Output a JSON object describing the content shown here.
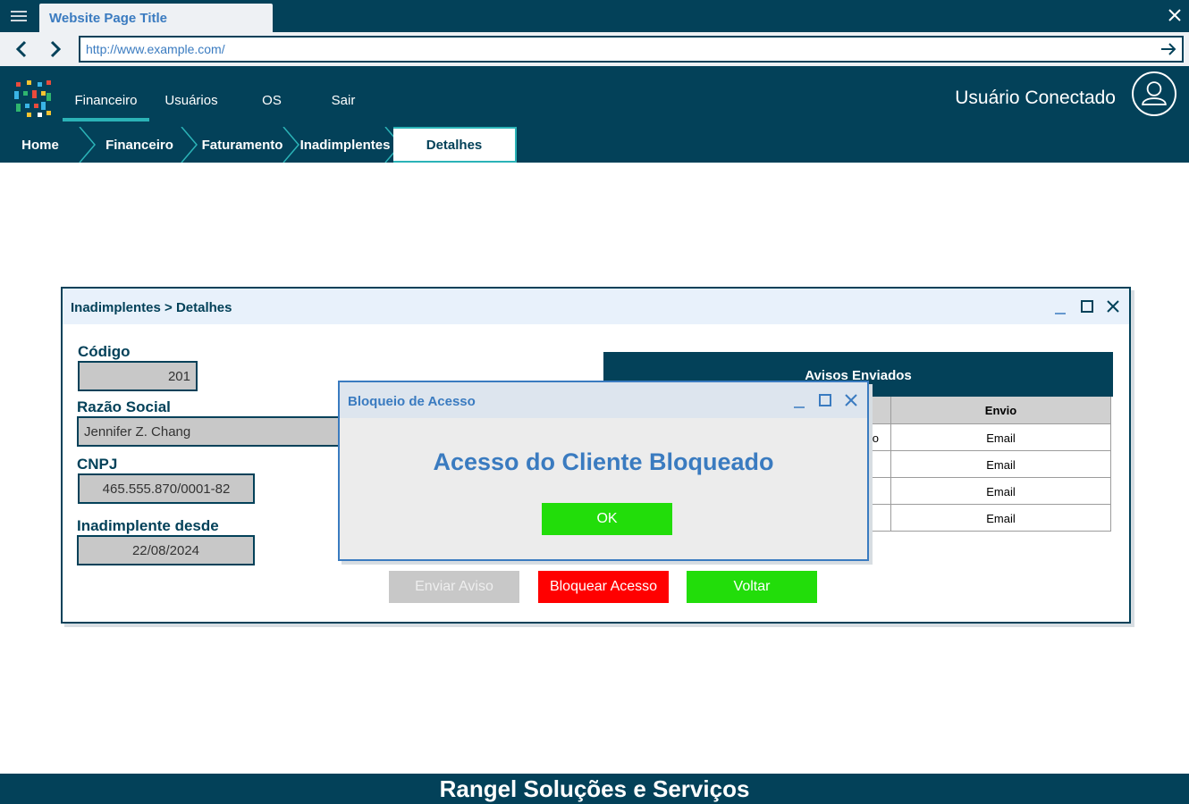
{
  "browser": {
    "tab_title": "Website Page Title",
    "url": "http://www.example.com/"
  },
  "header": {
    "nav": [
      {
        "label": "Financeiro",
        "active": true
      },
      {
        "label": "Usuários",
        "active": false
      },
      {
        "label": "OS",
        "active": false
      },
      {
        "label": "Sair",
        "active": false
      }
    ],
    "user_label": "Usuário Conectado",
    "logo_colors": [
      "#e94b3c",
      "#f5c431",
      "#3ab5e6",
      "#2fb56e"
    ]
  },
  "breadcrumb": [
    "Home",
    "Financeiro",
    "Faturamento",
    "Inadimplentes",
    "Detalhes"
  ],
  "window": {
    "title": "Inadimplentes > Detalhes",
    "fields": {
      "codigo": {
        "label": "Código",
        "value": "201"
      },
      "razao_social": {
        "label": "Razão Social",
        "value": "Jennifer Z. Chang"
      },
      "cnpj": {
        "label": "CNPJ",
        "value": "465.555.870/0001-82"
      },
      "inadimplente_desde": {
        "label": "Inadimplente desde",
        "value": "22/08/2024"
      }
    },
    "table": {
      "title": "Avisos Enviados",
      "columns": [
        "",
        "Envio"
      ],
      "rows": [
        [
          "to",
          "Email"
        ],
        [
          "",
          "Email"
        ],
        [
          "",
          "Email"
        ],
        [
          "",
          "Email"
        ]
      ]
    },
    "buttons": {
      "enviar": "Enviar Aviso",
      "bloquear": "Bloquear Acesso",
      "voltar": "Voltar"
    }
  },
  "modal": {
    "title": "Bloqueio de Acesso",
    "message": "Acesso do Cliente Bloqueado",
    "ok_label": "OK"
  },
  "footer": {
    "text": "Rangel Soluções e Serviços"
  },
  "colors": {
    "primary": "#034159",
    "accent": "#2bb3b7",
    "link_blue": "#3a7bc0",
    "green": "#22dd0a",
    "red": "#ff0000",
    "disabled": "#c8c8c8"
  }
}
